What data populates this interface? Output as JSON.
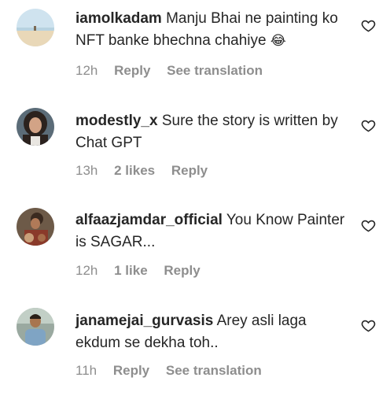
{
  "comments": [
    {
      "username": "iamolkadam",
      "text": "Manju Bhai ne painting ko NFT banke bhechna chahiye",
      "emoji": "😂",
      "time": "12h",
      "likes": "",
      "reply_label": "Reply",
      "translation_label": "See translation"
    },
    {
      "username": "modestly_x",
      "text": "Sure the story is written by Chat GPT",
      "emoji": "",
      "time": "13h",
      "likes": "2 likes",
      "reply_label": "Reply",
      "translation_label": ""
    },
    {
      "username": "alfaazjamdar_official",
      "text": "You Know Painter is SAGAR...",
      "emoji": "",
      "time": "12h",
      "likes": "1 like",
      "reply_label": "Reply",
      "translation_label": ""
    },
    {
      "username": "janamejai_gurvasis",
      "text": "Arey asli laga ekdum se dekha toh..",
      "emoji": "",
      "time": "11h",
      "likes": "",
      "reply_label": "Reply",
      "translation_label": "See translation"
    }
  ],
  "icons": {
    "like": "heart-outline-icon",
    "avatar": "avatar-photo"
  },
  "colors": {
    "text": "#262626",
    "meta": "#8e8e8e"
  }
}
